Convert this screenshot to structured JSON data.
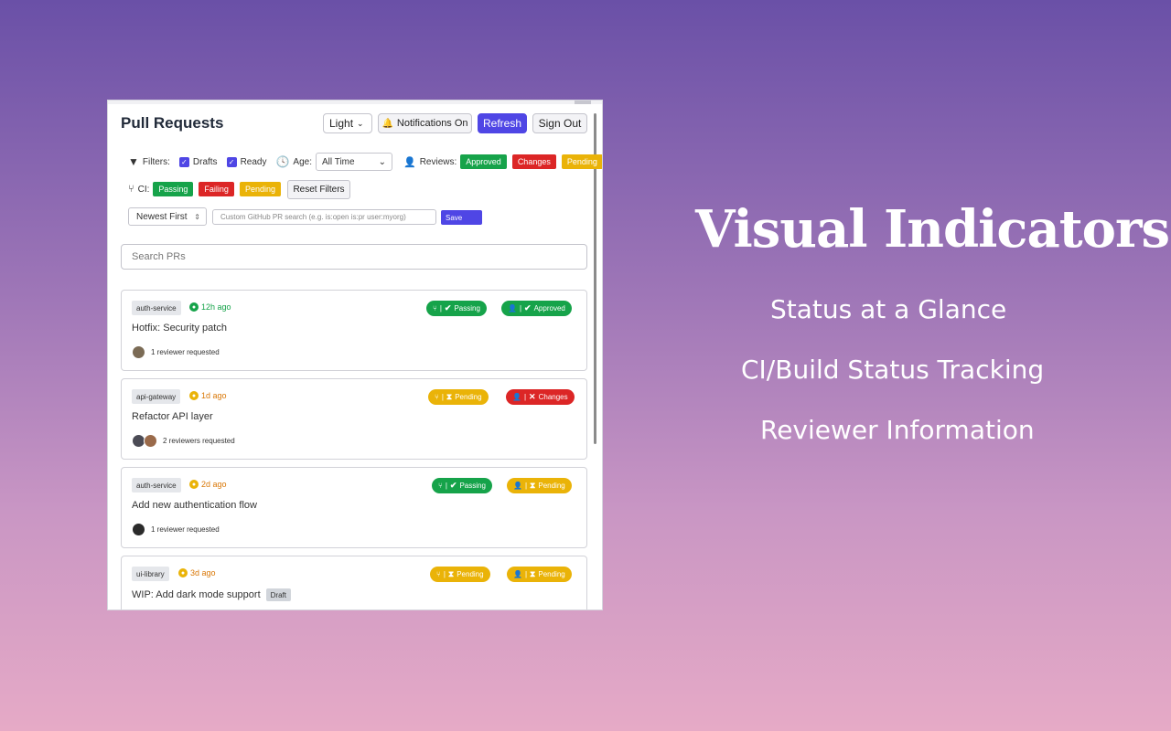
{
  "hero": {
    "headline": "Visual Indicators",
    "features": [
      "Status at a Glance",
      "CI/Build Status Tracking",
      "Reviewer Information"
    ]
  },
  "header": {
    "title": "Pull Requests",
    "theme_value": "Light",
    "notifications_label": "Notifications On",
    "refresh_label": "Refresh",
    "signout_label": "Sign Out"
  },
  "filters": {
    "label": "Filters:",
    "drafts_label": "Drafts",
    "ready_label": "Ready",
    "age_label": "Age:",
    "age_value": "All Time",
    "reviews_label": "Reviews:",
    "review_chips": [
      "Approved",
      "Changes",
      "Pending"
    ],
    "ci_label": "CI:",
    "ci_chips": [
      "Passing",
      "Failing",
      "Pending"
    ],
    "reset_label": "Reset Filters",
    "sort_value": "Newest First",
    "custom_placeholder": "Custom GitHub PR search (e.g. is:open is:pr user:myorg)",
    "save_label": "Save"
  },
  "search": {
    "placeholder": "Search PRs"
  },
  "prs": [
    {
      "repo": "auth-service",
      "age": "12h ago",
      "title": "Hotfix: Security patch",
      "reviewers": "1 reviewer requested",
      "ci": "Passing",
      "review": "Approved"
    },
    {
      "repo": "api-gateway",
      "age": "1d ago",
      "title": "Refactor API layer",
      "reviewers": "2 reviewers requested",
      "ci": "Pending",
      "review": "Changes"
    },
    {
      "repo": "auth-service",
      "age": "2d ago",
      "title": "Add new authentication flow",
      "reviewers": "1 reviewer requested",
      "ci": "Passing",
      "review": "Pending"
    },
    {
      "repo": "ui-library",
      "age": "3d ago",
      "title": "WIP: Add dark mode support",
      "draft": "Draft",
      "ci": "Pending",
      "review": "Pending"
    }
  ],
  "colors": {
    "accent": "#4f46e5",
    "green": "#16a34a",
    "red": "#dc2626",
    "yellow": "#eab308"
  }
}
